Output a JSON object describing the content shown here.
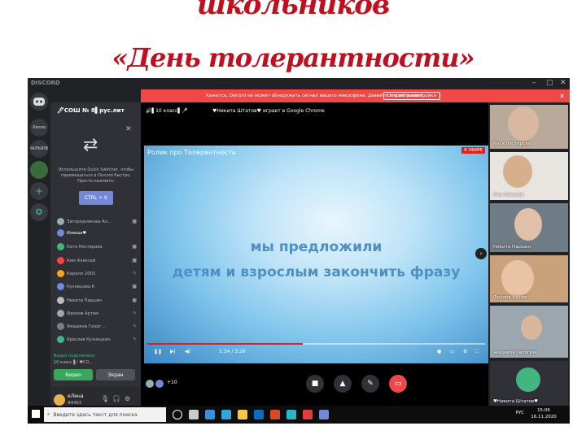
{
  "slide": {
    "title_line1": "школьников",
    "title_line2": "«День толерантности»"
  },
  "window": {
    "app_name": "DISCORD",
    "controls": [
      "–",
      "□",
      "✕"
    ]
  },
  "notice": {
    "message": "Кажется, Discord не может обнаружить сигнал вашего микрофона. Давайте это исправим!",
    "link": "Откройте настройки",
    "close": "✕"
  },
  "guilds": [
    "Хелло",
    "КАЛЬЯЛЕ",
    "+"
  ],
  "sidebar": {
    "server_name": "🖊СОШ № 8▌рус.лит",
    "quick_switcher_text": "Используйте Quick Switcher, чтобы перемещаться в Discord быстро. Просто нажмите:",
    "shortcut": "CTRL + K",
    "members": [
      {
        "name": "Загороднякова Ал...",
        "color": "#99aab5"
      },
      {
        "name": "Илюша♥",
        "color": "#7289da"
      },
      {
        "name": "Катя Нестерова",
        "color": "#43b581"
      },
      {
        "name": "Ким Алексей",
        "color": "#f04747"
      },
      {
        "name": "Кирилл 2003",
        "color": "#faa61a"
      },
      {
        "name": "Кузнецова К",
        "color": "#7289da"
      },
      {
        "name": "Никита Паршин",
        "color": "#b9bbbe"
      },
      {
        "name": "Фролов Артем",
        "color": "#99aab5"
      },
      {
        "name": "Ямщиков Георг...",
        "color": "#747f8d"
      },
      {
        "name": "Ярослав Кузнецкин",
        "color": "#43b581"
      }
    ],
    "voice_status": "Видео подключено",
    "voice_channel": "10 класс ▌/ ♥СО...",
    "video_button": "Видео",
    "screen_button": "Экран",
    "user_name": "еЛена",
    "user_tag": "#6493"
  },
  "main": {
    "channel": "🔊▌10 класс▌🎤",
    "activity": "♥Никита Штатов♥ играет в Google Chrome",
    "video_title": "Ролик про Толерантность",
    "live_badge": "В ЭФИРЕ",
    "caption_line1": "мы предложили",
    "caption_line2": "детям и взрослым закончить фразу",
    "time": "1:34 / 3:26",
    "progress": 0.46,
    "participants_extra": "+10"
  },
  "tiles": [
    {
      "name": "Катя Нестерова",
      "bg": "#b9a99a",
      "face": "#d8b8a0"
    },
    {
      "name": "Ким Алексей",
      "bg": "#e8e4e0",
      "face": "#d6b08c"
    },
    {
      "name": "Никита Паршин",
      "bg": "#6f7b85",
      "face": "#e0c0a8"
    },
    {
      "name": "Фролов Артем",
      "bg": "#c9a27c",
      "face": "#e8c4a4"
    },
    {
      "name": "Ямщиков Георгий",
      "bg": "#9ca6ae",
      "face": "#d9b79c"
    },
    {
      "name": "♥Никита Штатов♥",
      "bg": "#202225",
      "face": "#43b581"
    }
  ],
  "taskbar": {
    "search_placeholder": "Введите здесь текст для поиска",
    "lang": "РУС",
    "time": "15:06",
    "date": "16.11.2020"
  }
}
